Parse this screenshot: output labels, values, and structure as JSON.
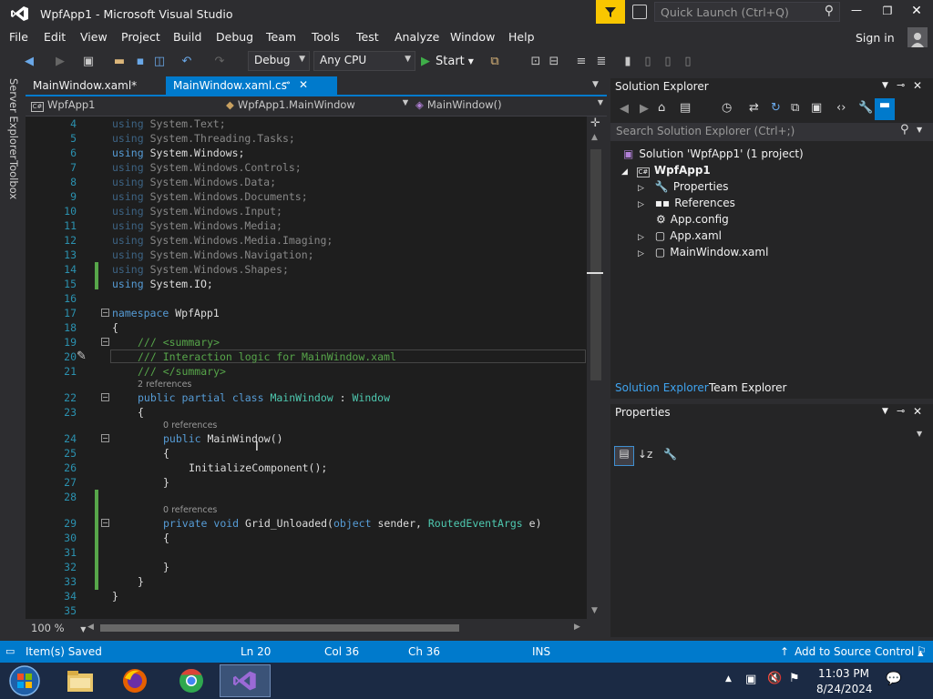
{
  "window": {
    "title": "WpfApp1 - Microsoft Visual Studio",
    "quick_launch_placeholder": "Quick Launch (Ctrl+Q)",
    "sign_in": "Sign in"
  },
  "menu": [
    "File",
    "Edit",
    "View",
    "Project",
    "Build",
    "Debug",
    "Team",
    "Tools",
    "Test",
    "Analyze",
    "Window",
    "Help"
  ],
  "toolbar": {
    "config": "Debug",
    "platform": "Any CPU",
    "start": "Start"
  },
  "left_tabs": [
    "Server Explorer",
    "Toolbox"
  ],
  "doc_tabs": [
    {
      "label": "MainWindow.xaml*"
    },
    {
      "label": "MainWindow.xaml.cs"
    }
  ],
  "nav": {
    "project": "WpfApp1",
    "class": "WpfApp1.MainWindow",
    "member": "MainWindow()"
  },
  "editor": {
    "line_numbers": [
      "4",
      "5",
      "6",
      "7",
      "8",
      "9",
      "10",
      "11",
      "12",
      "13",
      "14",
      "15",
      "16",
      "17",
      "18",
      "19",
      "20",
      "21",
      "22",
      "23",
      "24",
      "25",
      "26",
      "27",
      "28",
      "29",
      "30",
      "31",
      "32",
      "33",
      "34",
      "35"
    ],
    "codelens": [
      "2 references",
      "0 references",
      "0 references"
    ],
    "lines": {
      "l3": "System.Text;",
      "l4": "System.Threading.Tasks;",
      "l5": "System.Windows;",
      "l6": "System.Windows.Controls;",
      "l7": "System.Windows.Data;",
      "l8": "System.Windows.Documents;",
      "l9": "System.Windows.Input;",
      "l10": "System.Windows.Media;",
      "l11": "System.Windows.Media.Imaging;",
      "l12": "System.Windows.Navigation;",
      "l13": "System.Windows.Shapes;",
      "l14": "System.IO;",
      "ns": "WpfApp1",
      "s1": "/// <summary>",
      "s2": "/// Interaction logic for MainWindow.xaml",
      "s3": "/// </summary>",
      "cls": "MainWindow",
      "base": "Window",
      "ctor": "MainWindow()",
      "init": "InitializeComponent();",
      "handler": "Grid_Unloaded(",
      "args": "RoutedEventArgs",
      "argname": "sender,",
      "e": "e)"
    },
    "keywords": {
      "using": "using",
      "namespace": "namespace",
      "public": "public",
      "partial": "partial",
      "class": "class",
      "private": "private",
      "void": "void",
      "object": "object"
    },
    "zoom": "100 %"
  },
  "solution_explorer": {
    "title": "Solution Explorer",
    "search_placeholder": "Search Solution Explorer (Ctrl+;)",
    "items": [
      "Solution 'WpfApp1' (1 project)",
      "WpfApp1",
      "Properties",
      "References",
      "App.config",
      "App.xaml",
      "MainWindow.xaml"
    ],
    "tabs": [
      "Solution Explorer",
      "Team Explorer"
    ]
  },
  "properties": {
    "title": "Properties"
  },
  "status": {
    "message": "Item(s) Saved",
    "ln": "Ln 20",
    "col": "Col 36",
    "ch": "Ch 36",
    "mode": "INS",
    "source_control": "Add to Source Control"
  },
  "taskbar": {
    "time": "11:03 PM",
    "date": "8/24/2024"
  },
  "colors": {
    "accent": "#007acc",
    "keyword": "#569cd6",
    "type": "#4ec9b0",
    "comment": "#57a64a",
    "line_number": "#2b91af"
  }
}
